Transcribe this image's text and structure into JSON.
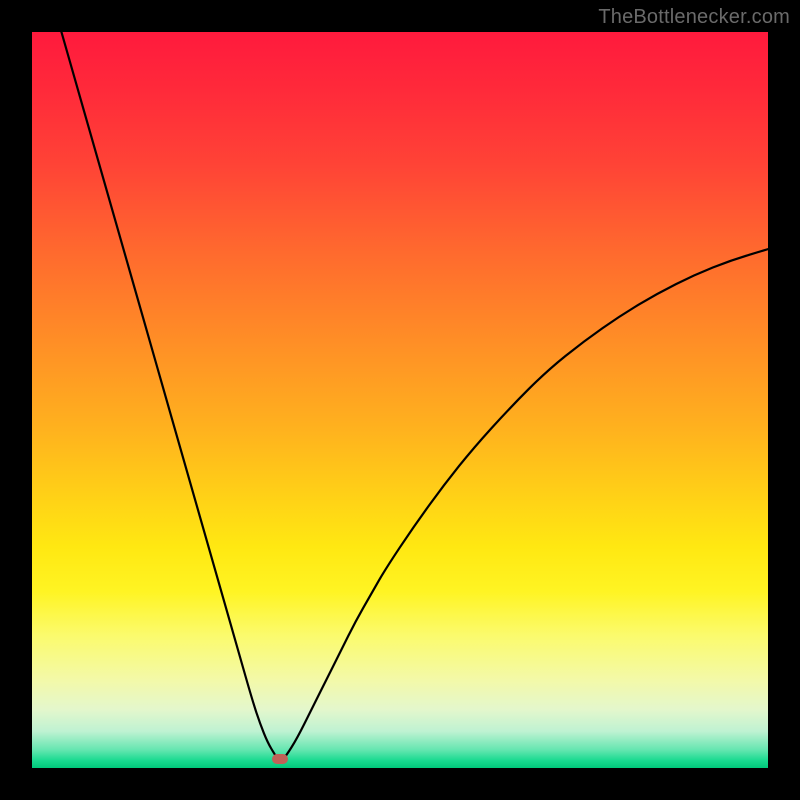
{
  "watermark": "TheBottlenecker.com",
  "colors": {
    "frame_bg": "#000000",
    "curve_stroke": "#000000",
    "marker_fill": "#c06358"
  },
  "chart_data": {
    "type": "line",
    "title": "",
    "xlabel": "",
    "ylabel": "",
    "xlim": [
      0,
      100
    ],
    "ylim": [
      0,
      100
    ],
    "annotations": [
      {
        "name": "marker",
        "x": 33.7,
        "y": 1.2
      }
    ],
    "series": [
      {
        "name": "bottleneck-curve",
        "x": [
          4,
          6,
          8,
          10,
          12,
          14,
          16,
          18,
          20,
          22,
          24,
          26,
          28,
          30,
          31,
          32,
          33,
          33.7,
          34.5,
          36,
          38,
          40,
          42,
          44,
          46,
          48,
          52,
          56,
          60,
          65,
          70,
          75,
          80,
          85,
          90,
          95,
          100
        ],
        "y": [
          100,
          93,
          86,
          79,
          72,
          65,
          58,
          51,
          44,
          37,
          30,
          23,
          16,
          9,
          6,
          3.5,
          1.8,
          0.8,
          1.6,
          4,
          8,
          12,
          16,
          20,
          23.5,
          27,
          33,
          38.5,
          43.5,
          49,
          54,
          58,
          61.5,
          64.5,
          67,
          69,
          70.5
        ]
      }
    ]
  }
}
